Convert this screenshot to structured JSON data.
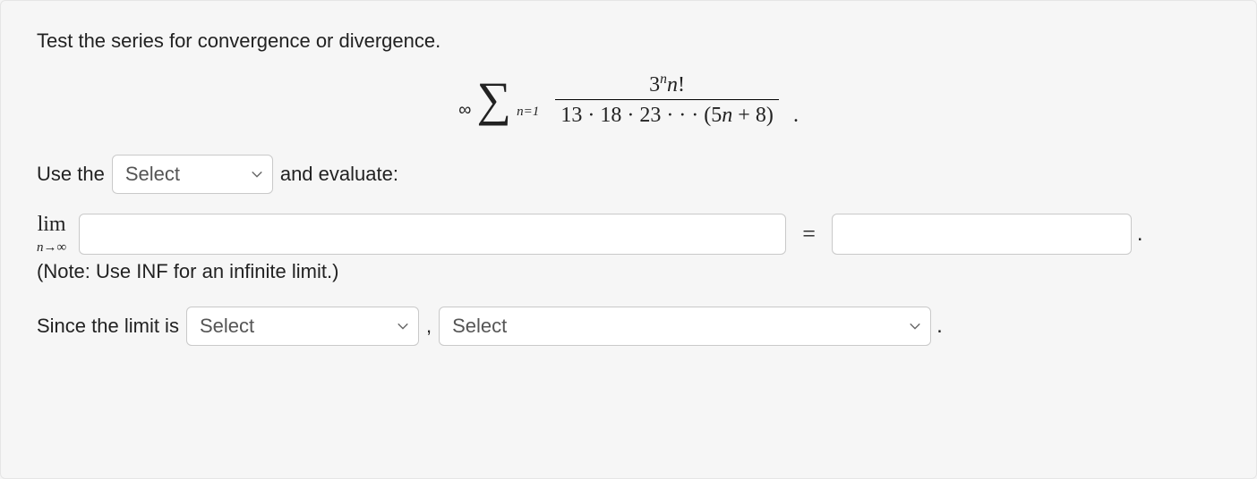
{
  "prompt": "Test the series for convergence or divergence.",
  "series": {
    "upper": "∞",
    "lower": "n=1",
    "numerator_html": "3<span class='sup'>n</span><span class='ital'>n</span>!",
    "denominator_html": "13 · 18 · 23 · · · (5<span class='ital'>n</span> + 8)"
  },
  "line2": {
    "prefix": "Use the",
    "select_placeholder": "Select",
    "suffix": "and evaluate:"
  },
  "limit": {
    "lim": "lim",
    "sub": "n→∞",
    "equals": "=",
    "input1_value": "",
    "input2_value": ""
  },
  "note": "(Note: Use INF for an infinite limit.)",
  "conclusion": {
    "prefix": "Since the limit is",
    "select1_placeholder": "Select",
    "comma": ",",
    "select2_placeholder": "Select",
    "period": "."
  },
  "glyphs": {
    "sigma": "∑"
  }
}
